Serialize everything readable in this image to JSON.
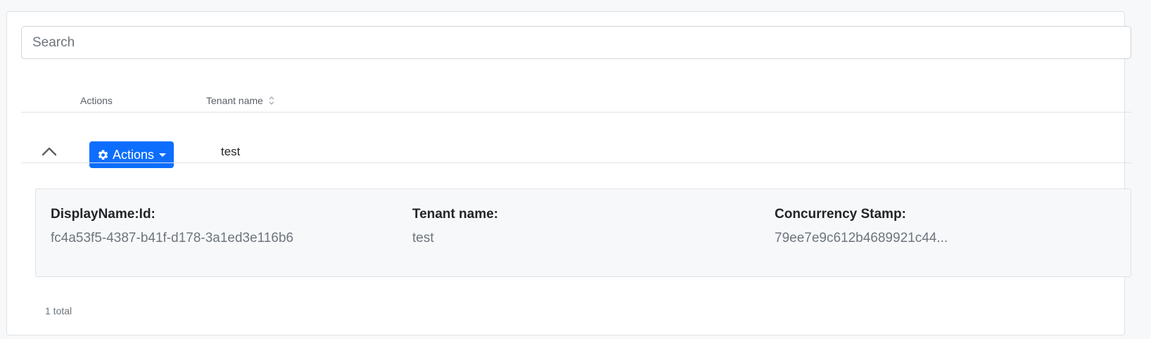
{
  "search": {
    "placeholder": "Search",
    "value": ""
  },
  "table": {
    "columns": [
      {
        "label": "Actions",
        "sortable": false
      },
      {
        "label": "Tenant name",
        "sortable": true
      }
    ],
    "rows": [
      {
        "expanded": true,
        "actions_label": "Actions",
        "tenant_name": "test",
        "details": [
          {
            "label": "DisplayName:Id:",
            "value": "fc4a53f5-4387-b41f-d178-3a1ed3e116b6"
          },
          {
            "label": "Tenant name:",
            "value": "test"
          },
          {
            "label": "Concurrency Stamp:",
            "value": "79ee7e9c612b4689921c44..."
          }
        ]
      }
    ]
  },
  "footer": {
    "total_text": "1 total"
  },
  "colors": {
    "primary": "#0d6efd",
    "muted_text": "#6c757d",
    "border": "#dee2e6",
    "page_bg": "#f7f8fa"
  },
  "icons": {
    "toggle": "chevron-up-icon",
    "actions": "gear-icon",
    "dropdown": "caret-down-icon",
    "sort": "sort-icon"
  }
}
